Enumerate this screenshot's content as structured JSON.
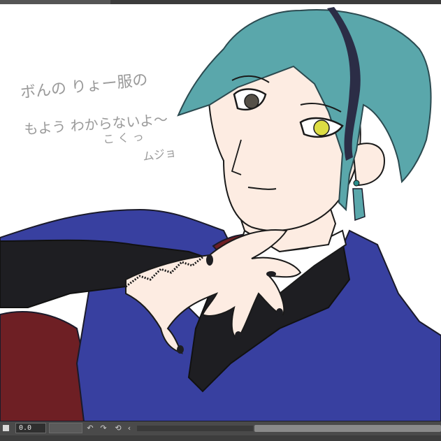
{
  "window": {
    "top_tab_label": ""
  },
  "canvas": {
    "handwritten_note": {
      "line1": "ボんの りょー服の",
      "line2": "もよう わからないよ〜",
      "line3": "こ く っ",
      "signature": "ムジョ"
    }
  },
  "timeline": {
    "frame_value": "0.0",
    "controls": {
      "undo_icon": "↶",
      "redo_icon": "↷",
      "history_icon": "⟲",
      "collapse_icon": "‹"
    }
  },
  "colors": {
    "background": "#ffffff",
    "hair": "#5aa7ab",
    "hair_dark": "#2b2d46",
    "skin": "#fdece2",
    "robe": "#3840a0",
    "lining": "#6e1f24",
    "inner": "#1e1e22",
    "eye_left": "#555048",
    "eye_right": "#dddd44",
    "toolbar": "#4a4a4a"
  }
}
